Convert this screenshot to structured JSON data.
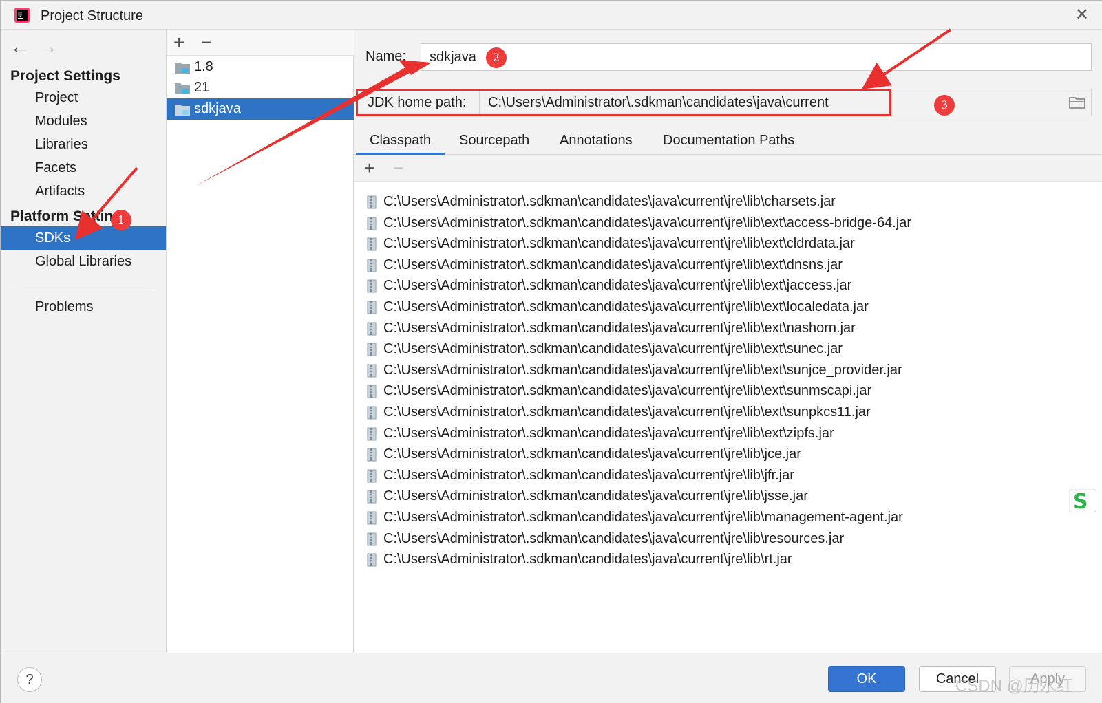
{
  "window": {
    "title": "Project Structure"
  },
  "sidebar": {
    "project_settings_header": "Project Settings",
    "project_items": [
      "Project",
      "Modules",
      "Libraries",
      "Facets",
      "Artifacts"
    ],
    "platform_settings_header": "Platform Settings",
    "platform_items": [
      "SDKs",
      "Global Libraries"
    ],
    "selected": "SDKs",
    "problems": "Problems"
  },
  "sdk_list": {
    "items": [
      "1.8",
      "21",
      "sdkjava"
    ],
    "selected": "sdkjava",
    "add": "+",
    "remove": "−"
  },
  "detail": {
    "name_label": "Name:",
    "name_value": "sdkjava",
    "jdk_home_label": "JDK home path:",
    "jdk_home_value": "C:\\Users\\Administrator\\.sdkman\\candidates\\java\\current",
    "tabs": [
      "Classpath",
      "Sourcepath",
      "Annotations",
      "Documentation Paths"
    ],
    "active_tab": "Classpath",
    "path_add": "+",
    "path_remove": "−",
    "paths": [
      "C:\\Users\\Administrator\\.sdkman\\candidates\\java\\current\\jre\\lib\\charsets.jar",
      "C:\\Users\\Administrator\\.sdkman\\candidates\\java\\current\\jre\\lib\\ext\\access-bridge-64.jar",
      "C:\\Users\\Administrator\\.sdkman\\candidates\\java\\current\\jre\\lib\\ext\\cldrdata.jar",
      "C:\\Users\\Administrator\\.sdkman\\candidates\\java\\current\\jre\\lib\\ext\\dnsns.jar",
      "C:\\Users\\Administrator\\.sdkman\\candidates\\java\\current\\jre\\lib\\ext\\jaccess.jar",
      "C:\\Users\\Administrator\\.sdkman\\candidates\\java\\current\\jre\\lib\\ext\\localedata.jar",
      "C:\\Users\\Administrator\\.sdkman\\candidates\\java\\current\\jre\\lib\\ext\\nashorn.jar",
      "C:\\Users\\Administrator\\.sdkman\\candidates\\java\\current\\jre\\lib\\ext\\sunec.jar",
      "C:\\Users\\Administrator\\.sdkman\\candidates\\java\\current\\jre\\lib\\ext\\sunjce_provider.jar",
      "C:\\Users\\Administrator\\.sdkman\\candidates\\java\\current\\jre\\lib\\ext\\sunmscapi.jar",
      "C:\\Users\\Administrator\\.sdkman\\candidates\\java\\current\\jre\\lib\\ext\\sunpkcs11.jar",
      "C:\\Users\\Administrator\\.sdkman\\candidates\\java\\current\\jre\\lib\\ext\\zipfs.jar",
      "C:\\Users\\Administrator\\.sdkman\\candidates\\java\\current\\jre\\lib\\jce.jar",
      "C:\\Users\\Administrator\\.sdkman\\candidates\\java\\current\\jre\\lib\\jfr.jar",
      "C:\\Users\\Administrator\\.sdkman\\candidates\\java\\current\\jre\\lib\\jsse.jar",
      "C:\\Users\\Administrator\\.sdkman\\candidates\\java\\current\\jre\\lib\\management-agent.jar",
      "C:\\Users\\Administrator\\.sdkman\\candidates\\java\\current\\jre\\lib\\resources.jar",
      "C:\\Users\\Administrator\\.sdkman\\candidates\\java\\current\\jre\\lib\\rt.jar"
    ]
  },
  "buttons": {
    "help": "?",
    "ok": "OK",
    "cancel": "Cancel",
    "apply": "Apply"
  },
  "annotations": {
    "badge_1": "1",
    "badge_2": "2",
    "badge_3": "3"
  },
  "watermark": "CSDN @历水红",
  "colors": {
    "selection": "#2f73c4",
    "accent": "#3574d0",
    "annotation_red": "#e8302f"
  }
}
